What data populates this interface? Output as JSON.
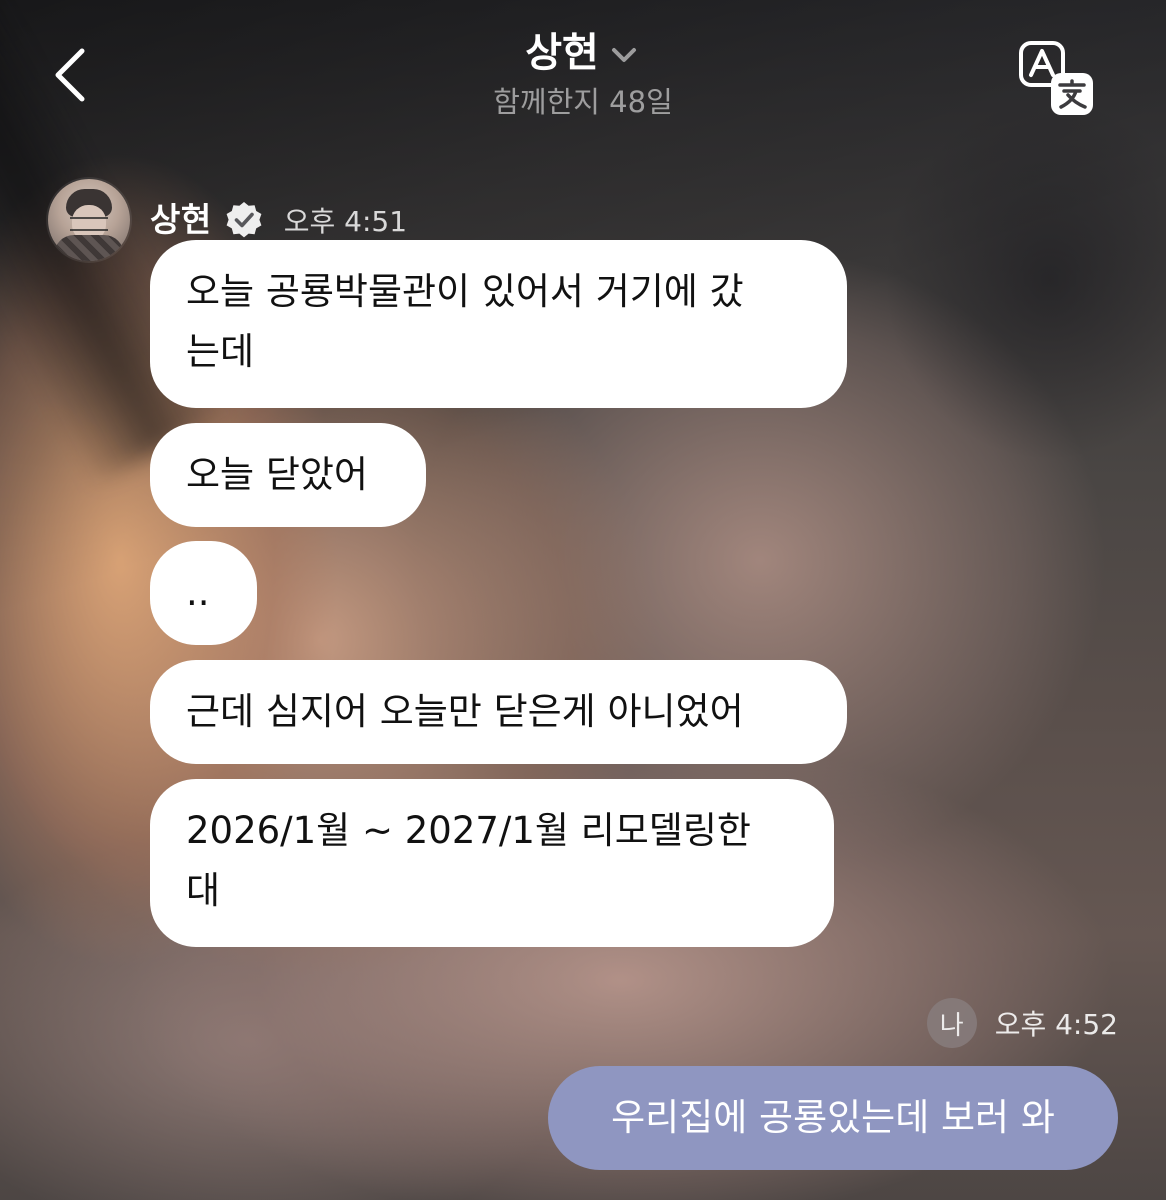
{
  "header": {
    "title": "상현",
    "subtitle": "함께한지 48일"
  },
  "thread": {
    "sender": {
      "name": "상현",
      "time": "오후 4:51"
    },
    "incoming": [
      {
        "text": "오늘 공룡박물관이 있어서 거기에 갔\n는데"
      },
      {
        "text": "오늘 닫았어"
      },
      {
        "text": ".."
      },
      {
        "text": "근데 심지어 오늘만 닫은게 아니었어"
      },
      {
        "text": "2026/1월 ~ 2027/1월 리모델링한\n대"
      }
    ],
    "me": {
      "badge": "나",
      "time": "오후 4:52",
      "text": "우리집에 공룡있는데 보러 와"
    }
  }
}
